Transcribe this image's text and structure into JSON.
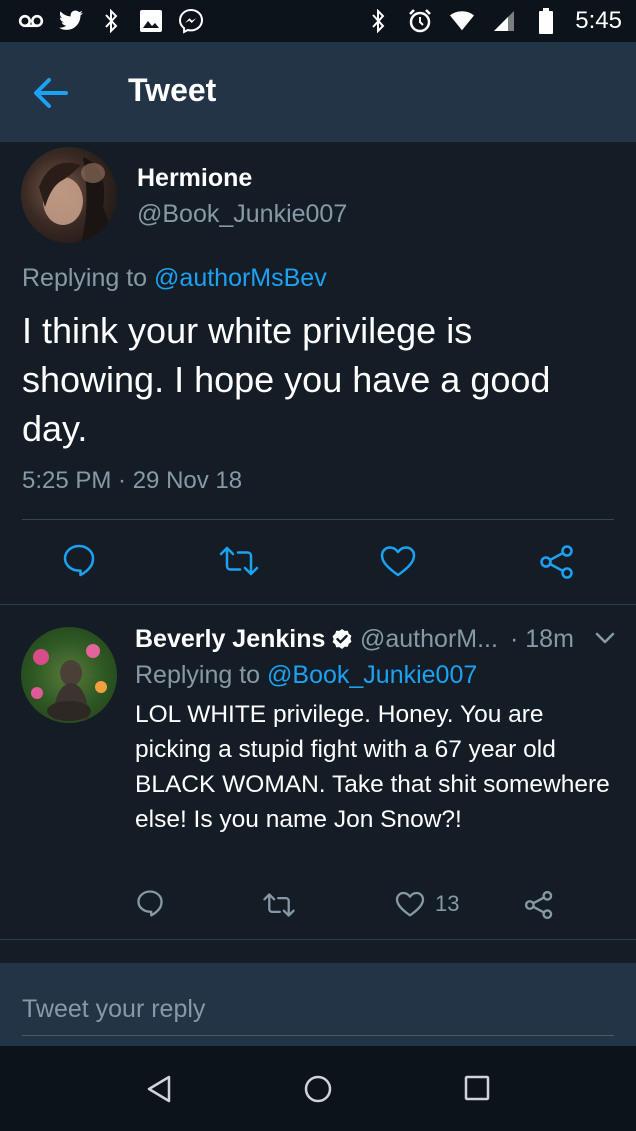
{
  "status_bar": {
    "time": "5:45",
    "left_icons": [
      "voicemail-icon",
      "twitter-icon",
      "bluetooth-icon",
      "image-icon",
      "messenger-icon"
    ],
    "right_icons": [
      "bluetooth-icon",
      "alarm-icon",
      "wifi-icon",
      "signal-icon",
      "battery-icon"
    ]
  },
  "header": {
    "title": "Tweet",
    "back_icon": "arrow-left-icon"
  },
  "main_tweet": {
    "name": "Hermione",
    "handle": "@Book_Junkie007",
    "replying_prefix": "Replying to",
    "replying_to": "@authorMsBev",
    "text": "I think your white privilege is showing. I hope you have a good day.",
    "timestamp": "5:25 PM · 29 Nov 18",
    "actions": [
      "reply-icon",
      "retweet-icon",
      "like-icon",
      "share-icon"
    ]
  },
  "reply_tweet": {
    "name": "Beverly Jenkins",
    "verified": true,
    "handle": "@authorM...",
    "time": "· 18m",
    "replying_prefix": "Replying to",
    "replying_to": "@Book_Junkie007",
    "text": "LOL WHITE privilege. Honey. You are picking a stupid fight with a 67 year old BLACK WOMAN.  Take that shit somewhere else! Is you name Jon Snow?!",
    "like_count": "13"
  },
  "reply_box": {
    "placeholder": "Tweet your reply"
  },
  "colors": {
    "background": "#141d26",
    "header": "#243447",
    "accent": "#1da1f2",
    "muted": "#8899a6"
  }
}
